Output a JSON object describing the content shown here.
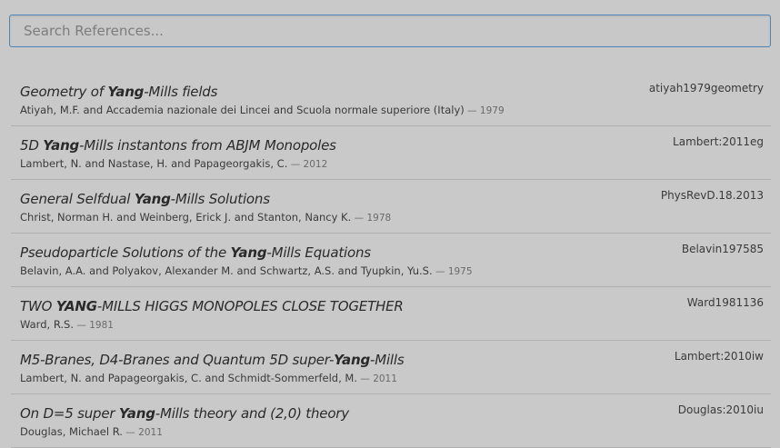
{
  "search": {
    "placeholder": "Search References..."
  },
  "references": [
    {
      "title_pre": "Geometry of ",
      "title_hl": "Yang",
      "title_post": "-Mills fields",
      "authors": "Atiyah, M.F. and Accademia nazionale dei Lincei and Scuola normale superiore (Italy)",
      "sep": " — ",
      "year": "1979",
      "key": "atiyah1979geometry"
    },
    {
      "title_pre": "5D ",
      "title_hl": "Yang",
      "title_post": "-Mills instantons from ABJM Monopoles",
      "authors": "Lambert, N. and Nastase, H. and Papageorgakis, C.",
      "sep": " — ",
      "year": "2012",
      "key": "Lambert:2011eg"
    },
    {
      "title_pre": "General Selfdual ",
      "title_hl": "Yang",
      "title_post": "-Mills Solutions",
      "authors": "Christ, Norman H. and Weinberg, Erick J. and Stanton, Nancy K.",
      "sep": " — ",
      "year": "1978",
      "key": "PhysRevD.18.2013"
    },
    {
      "title_pre": "Pseudoparticle Solutions of the ",
      "title_hl": "Yang",
      "title_post": "-Mills Equations",
      "authors": "Belavin, A.A. and Polyakov, Alexander M. and Schwartz, A.S. and Tyupkin, Yu.S.",
      "sep": " — ",
      "year": "1975",
      "key": "Belavin197585"
    },
    {
      "title_pre": "TWO ",
      "title_hl": "YANG",
      "title_post": "-MILLS HIGGS MONOPOLES CLOSE TOGETHER",
      "authors": "Ward, R.S.",
      "sep": " — ",
      "year": "1981",
      "key": "Ward1981136"
    },
    {
      "title_pre": "M5-Branes, D4-Branes and Quantum 5D super-",
      "title_hl": "Yang",
      "title_post": "-Mills",
      "authors": "Lambert, N. and Papageorgakis, C. and Schmidt-Sommerfeld, M.",
      "sep": " — ",
      "year": "2011",
      "key": "Lambert:2010iw"
    },
    {
      "title_pre": "On D=5 super ",
      "title_hl": "Yang",
      "title_post": "-Mills theory and (2,0) theory",
      "authors": "Douglas, Michael R.",
      "sep": " — ",
      "year": "2011",
      "key": "Douglas:2010iu"
    }
  ]
}
